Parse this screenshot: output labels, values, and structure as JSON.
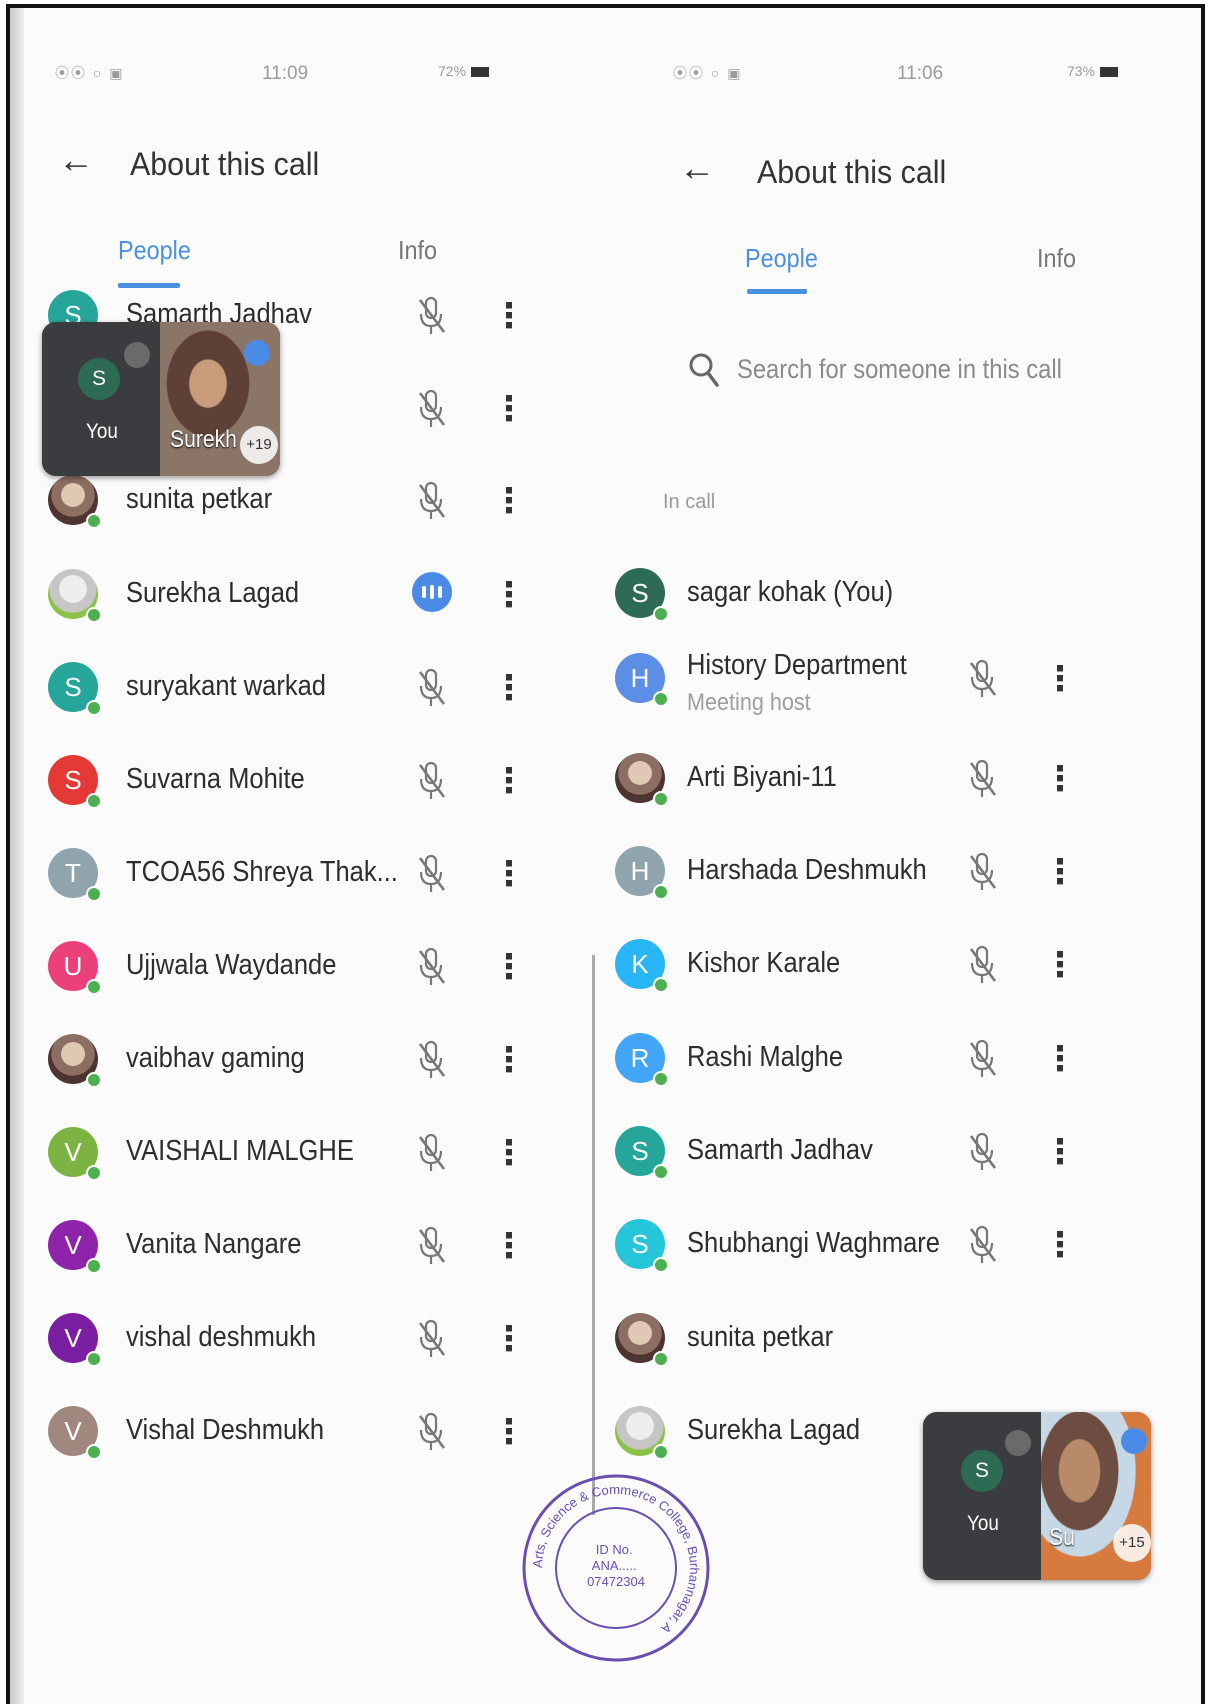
{
  "left": {
    "status": {
      "signal": "⦿⦿ ○ ▣",
      "time": "11:09",
      "battery": "72%"
    },
    "header": {
      "title": "About this call"
    },
    "tabs": [
      {
        "label": "People",
        "active": true
      },
      {
        "label": "Info",
        "active": false
      }
    ],
    "people": [
      {
        "name": "Samarth Jadhav",
        "initial": "S",
        "color": "#26a69a",
        "status": "muted"
      },
      {
        "name": "",
        "initial": "",
        "color": "",
        "status": "muted"
      },
      {
        "name": "sunita petkar",
        "initial": "",
        "color": "",
        "status": "muted"
      },
      {
        "name": "Surekha Lagad",
        "initial": "",
        "color": "",
        "status": "speaking"
      },
      {
        "name": "suryakant warkad",
        "initial": "S",
        "color": "#26a69a",
        "status": "muted"
      },
      {
        "name": "Suvarna Mohite",
        "initial": "S",
        "color": "#e53935",
        "status": "muted"
      },
      {
        "name": "TCOA56 Shreya Thak...",
        "initial": "T",
        "color": "#90a4ae",
        "status": "muted"
      },
      {
        "name": "Ujjwala Waydande",
        "initial": "U",
        "color": "#ec407a",
        "status": "muted"
      },
      {
        "name": "vaibhav gaming",
        "initial": "",
        "color": "",
        "status": "muted"
      },
      {
        "name": "VAISHALI MALGHE",
        "initial": "V",
        "color": "#7cb342",
        "status": "muted"
      },
      {
        "name": "Vanita Nangare",
        "initial": "V",
        "color": "#8e24aa",
        "status": "muted"
      },
      {
        "name": "vishal deshmukh",
        "initial": "V",
        "color": "#7b1fa2",
        "status": "muted"
      },
      {
        "name": "Vishal Deshmukh",
        "initial": "V",
        "color": "#a1887f",
        "status": "muted"
      }
    ],
    "pip": {
      "you_initial": "S",
      "you_label": "You",
      "video_name": "Surekh",
      "plus_count": "+19"
    }
  },
  "right": {
    "status": {
      "signal": "⦿⦿ ○ ▣",
      "time": "11:06",
      "battery": "73%"
    },
    "header": {
      "title": "About this call"
    },
    "tabs": [
      {
        "label": "People",
        "active": true
      },
      {
        "label": "Info",
        "active": false
      }
    ],
    "search": {
      "placeholder": "Search for someone in this call"
    },
    "section_label": "In call",
    "people": [
      {
        "name": "sagar kohak (You)",
        "initial": "S",
        "color": "#2e6b55",
        "status": "none",
        "sub": ""
      },
      {
        "name": "History Department",
        "initial": "H",
        "color": "#5c8ee6",
        "status": "muted",
        "sub": "Meeting host"
      },
      {
        "name": "Arti Biyani-11",
        "initial": "",
        "color": "",
        "status": "muted",
        "sub": ""
      },
      {
        "name": "Harshada Deshmukh",
        "initial": "H",
        "color": "#90a4ae",
        "status": "muted",
        "sub": ""
      },
      {
        "name": "Kishor Karale",
        "initial": "K",
        "color": "#29b6f6",
        "status": "muted",
        "sub": ""
      },
      {
        "name": "Rashi Malghe",
        "initial": "R",
        "color": "#42a5f5",
        "status": "muted",
        "sub": ""
      },
      {
        "name": "Samarth Jadhav",
        "initial": "S",
        "color": "#26a69a",
        "status": "muted",
        "sub": ""
      },
      {
        "name": "Shubhangi Waghmare",
        "initial": "S",
        "color": "#26c6da",
        "status": "muted",
        "sub": ""
      },
      {
        "name": "sunita petkar",
        "initial": "",
        "color": "",
        "status": "none",
        "sub": ""
      },
      {
        "name": "Surekha Lagad",
        "initial": "",
        "color": "",
        "status": "none",
        "sub": ""
      }
    ],
    "pip": {
      "you_initial": "S",
      "you_label": "You",
      "video_name": "Su",
      "plus_count": "+15"
    }
  },
  "stamp": {
    "top_text": "Arts, Science & Commerce College, Burhannagar, A",
    "center_text": "ID No.\nANA.....\n07472304"
  },
  "colors": {
    "accent": "#4a90e2",
    "online": "#4caf50",
    "speaking": "#4a8be8"
  }
}
